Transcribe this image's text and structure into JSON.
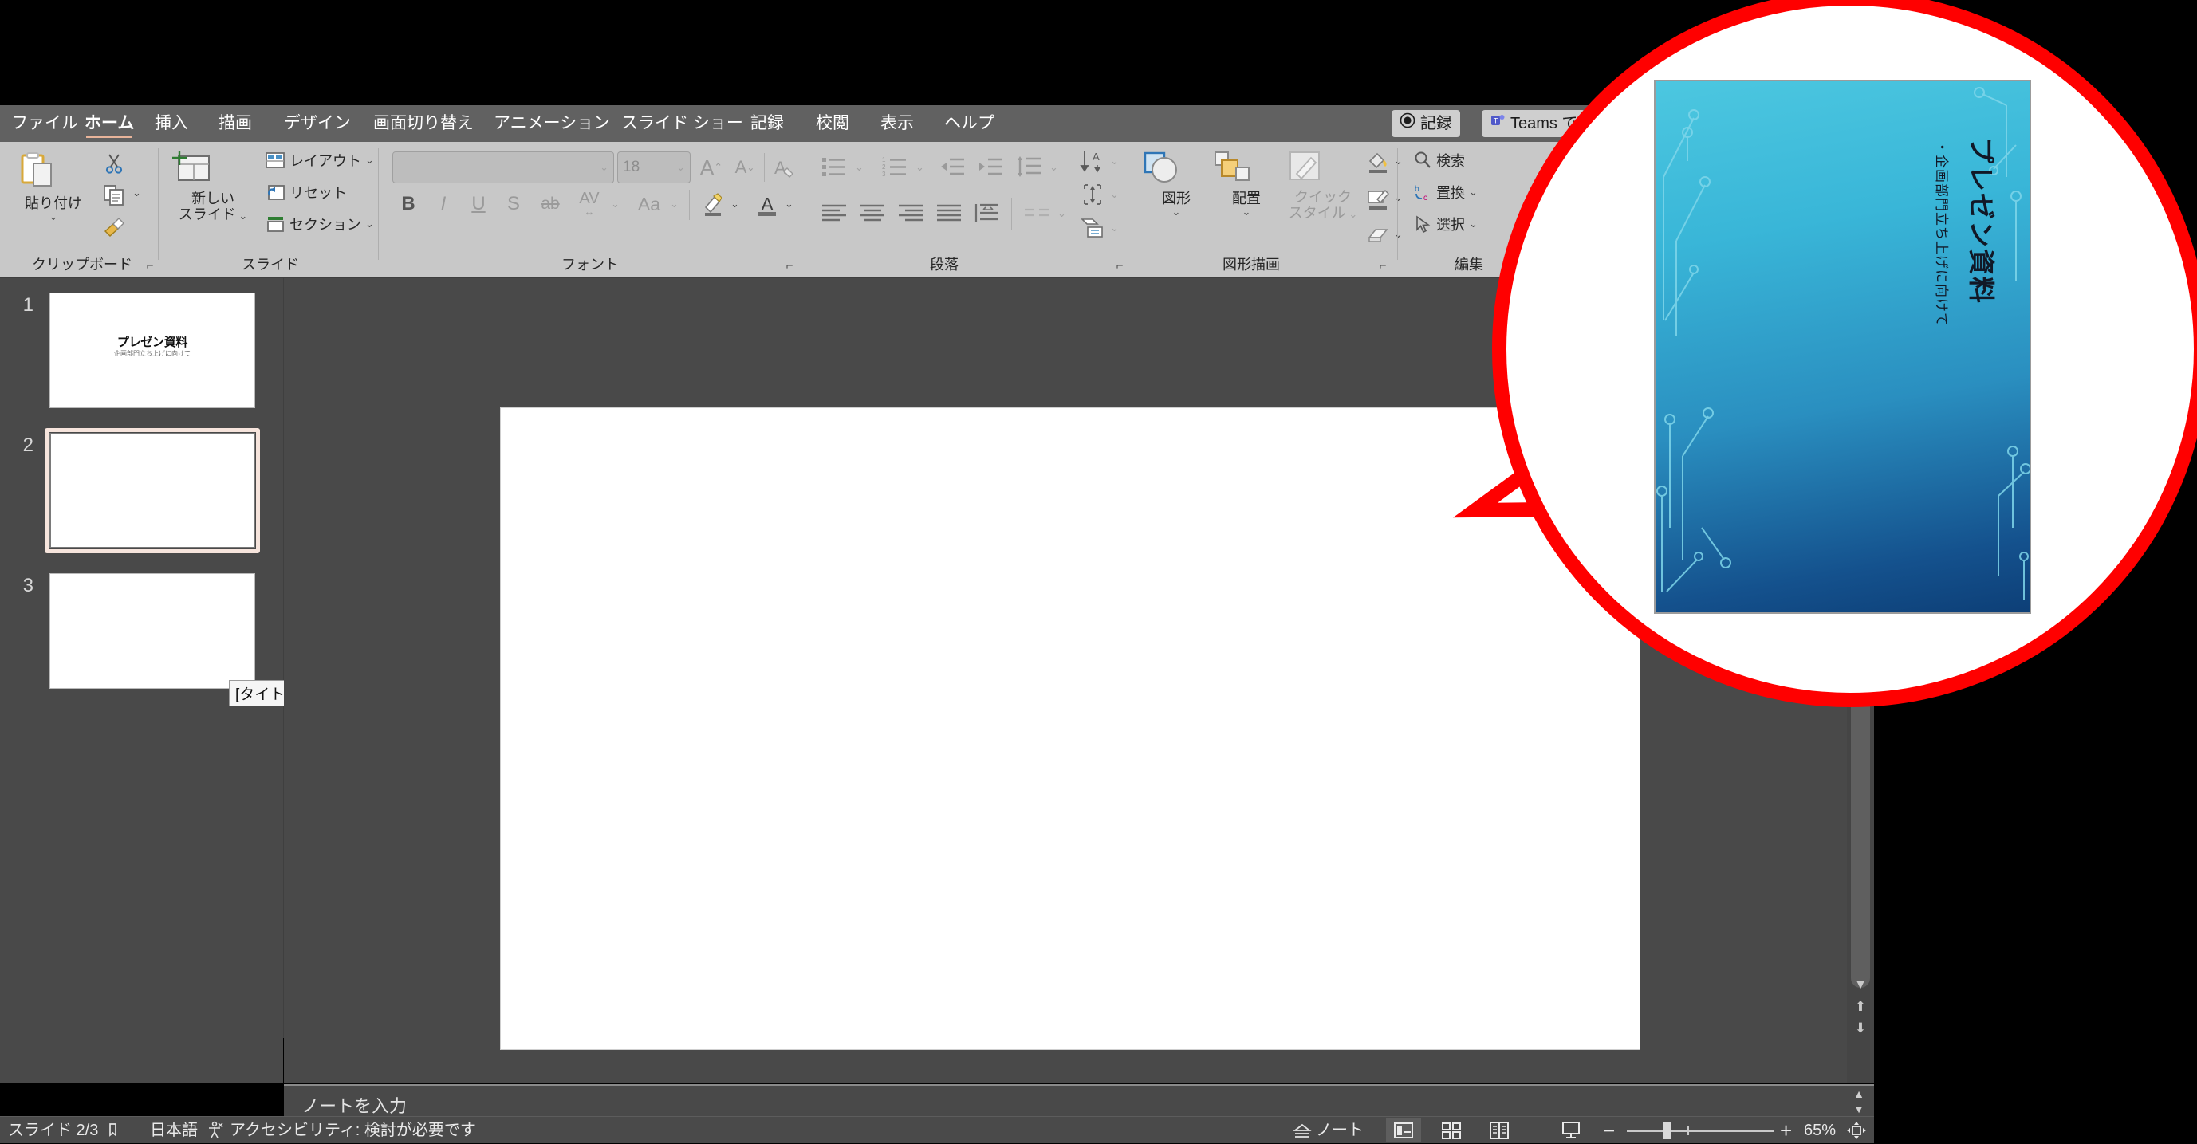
{
  "app": {
    "name": "PowerPoint"
  },
  "ribbon": {
    "tabs": [
      {
        "label": "ファイル",
        "active": false
      },
      {
        "label": "ホーム",
        "active": true
      },
      {
        "label": "挿入",
        "active": false
      },
      {
        "label": "描画",
        "active": false
      },
      {
        "label": "デザイン",
        "active": false
      },
      {
        "label": "画面切り替え",
        "active": false
      },
      {
        "label": "アニメーション",
        "active": false
      },
      {
        "label": "スライド ショー",
        "active": false
      },
      {
        "label": "記録",
        "active": false
      },
      {
        "label": "校閲",
        "active": false
      },
      {
        "label": "表示",
        "active": false
      },
      {
        "label": "ヘルプ",
        "active": false
      }
    ],
    "record_button": "記録",
    "teams_button": "Teams で",
    "groups": {
      "clipboard": {
        "label": "クリップボード",
        "paste": "貼り付け",
        "cut_icon": "scissors-icon",
        "copy_icon": "copy-icon",
        "format_painter_icon": "format-painter-icon"
      },
      "slides": {
        "label": "スライド",
        "new_slide": "新しい\nスライド",
        "new_slide_line1": "新しい",
        "new_slide_line2": "スライド",
        "layout": "レイアウト",
        "reset": "リセット",
        "section": "セクション"
      },
      "font": {
        "label": "フォント",
        "font_name_value": "",
        "font_size_value": "18",
        "bold": "B",
        "italic": "I",
        "underline": "U",
        "shadow": "S",
        "strikethrough": "ab",
        "char_spacing": "AV",
        "change_case": "Aa"
      },
      "paragraph": {
        "label": "段落"
      },
      "drawing": {
        "label": "図形描画",
        "shapes": "図形",
        "arrange": "配置",
        "quick_styles_line1": "クイック",
        "quick_styles_line2": "スタイル"
      },
      "editing": {
        "label": "編集",
        "find": "検索",
        "replace": "置換",
        "select": "選択"
      }
    }
  },
  "slide_panel": {
    "slides": [
      {
        "number": "1",
        "title": "プレゼン資料",
        "subtitle": "企画部門立ち上げに向けて",
        "selected": false
      },
      {
        "number": "2",
        "title": "",
        "subtitle": "",
        "selected": true
      },
      {
        "number": "3",
        "title": "",
        "subtitle": "",
        "selected": false
      }
    ],
    "tooltip": "[タイトルなし]"
  },
  "notes": {
    "placeholder": "ノートを入力"
  },
  "status": {
    "slide_counter": "スライド 2/3",
    "language": "日本語",
    "accessibility": "アクセシビリティ: 検討が必要です",
    "notes_button": "ノート",
    "zoom_level": "65%",
    "zoom_minus": "−",
    "zoom_plus": "+"
  },
  "callout": {
    "border_color": "#FF0000",
    "slide_title": "プレゼン資料",
    "slide_bullet": "・企画部門立ち上げに向けて"
  }
}
